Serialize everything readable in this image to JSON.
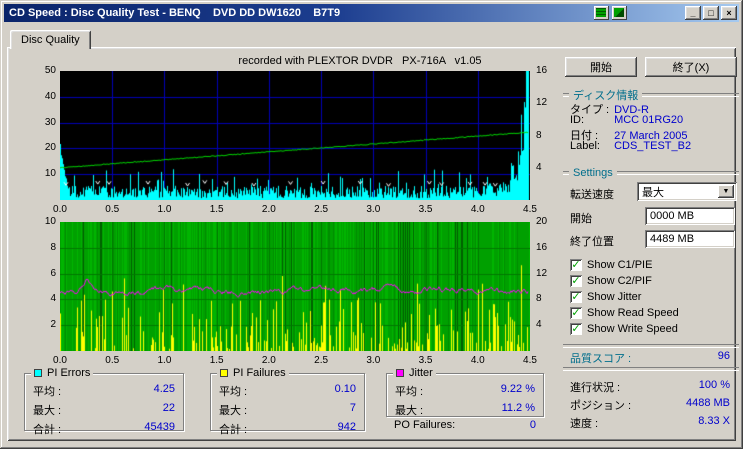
{
  "window": {
    "title": "CD Speed : Disc Quality Test - BENQ    DVD DD DW1620    B7T9"
  },
  "icons": {
    "minimize": "_",
    "maximize": "□",
    "close": "×",
    "check": "✓",
    "dropdown": "▼"
  },
  "tab": {
    "label": "Disc Quality"
  },
  "chart_note": "recorded with PLEXTOR DVDR   PX-716A   v1.05",
  "chart_data": [
    {
      "type": "area",
      "title": "PI Errors / Write Speed",
      "x_ticks": [
        "0.0",
        "0.5",
        "1.0",
        "1.5",
        "2.0",
        "2.5",
        "3.0",
        "3.5",
        "4.0",
        "4.5"
      ],
      "y_left_ticks": [
        "50",
        "40",
        "30",
        "20",
        "10"
      ],
      "y_right_ticks": [
        "16",
        "12",
        "8",
        "4"
      ],
      "y_left_max": 50,
      "y_right_max": 16,
      "x_max": 4.5,
      "x_data_end": 4.48,
      "h_grid": [
        10,
        20,
        30,
        40
      ],
      "grid_color": "#0000b8",
      "bg": "#000000",
      "series": [
        {
          "name": "PI Errors",
          "color": "#00ffff",
          "avg": 4.25,
          "max": 22,
          "total": 45439
        },
        {
          "name": "Write Speed",
          "color": "#00d800",
          "start_x": 4.0,
          "end_x": 8.4
        }
      ]
    },
    {
      "type": "spikes",
      "title": "PI Failures / Jitter",
      "x_ticks": [
        "0.0",
        "0.5",
        "1.0",
        "1.5",
        "2.0",
        "2.5",
        "3.0",
        "3.5",
        "4.0",
        "4.5"
      ],
      "y_left_ticks": [
        "10",
        "8",
        "6",
        "4",
        "2"
      ],
      "y_right_ticks": [
        "20",
        "16",
        "12",
        "8",
        "4"
      ],
      "y_left_max": 10,
      "y_right_max": 20,
      "x_max": 4.5,
      "x_data_end": 4.48,
      "h_grid": [
        2,
        4,
        6,
        8
      ],
      "grid_color": "#007800",
      "bg": "#00a000",
      "series": [
        {
          "name": "PI Failures",
          "color": "#ffff00",
          "avg": 0.1,
          "max": 7,
          "total": 942
        },
        {
          "name": "Jitter",
          "color": "#ff00ff",
          "avg_pct": 9.22,
          "max_pct": 11.2
        }
      ]
    }
  ],
  "stats": {
    "pi_errors": {
      "title": "PI Errors",
      "color": "#00ffff",
      "rows": [
        {
          "label": "平均 :",
          "value": "4.25"
        },
        {
          "label": "最大 :",
          "value": "22"
        },
        {
          "label": "合計 :",
          "value": "45439"
        }
      ]
    },
    "pi_failures": {
      "title": "PI Failures",
      "color": "#ffff00",
      "rows": [
        {
          "label": "平均 :",
          "value": "0.10"
        },
        {
          "label": "最大 :",
          "value": "7"
        },
        {
          "label": "合計 :",
          "value": "942"
        }
      ]
    },
    "jitter": {
      "title": "Jitter",
      "color": "#ff00ff",
      "rows": [
        {
          "label": "平均 :",
          "value": "9.22 %"
        },
        {
          "label": "最大 :",
          "value": "11.2 %"
        }
      ]
    },
    "po_failures": {
      "label": "PO Failures:",
      "value": "0"
    }
  },
  "sidebar": {
    "start_button": "開始",
    "exit_button": "終了(X)",
    "disc_info": {
      "title": "ディスク情報",
      "rows": [
        {
          "label": "タイプ :",
          "value": "DVD-R"
        },
        {
          "label": "ID:",
          "value": "MCC 01RG20"
        },
        {
          "label": "日付 :",
          "value": "27 March 2005"
        },
        {
          "label": "Label:",
          "value": "CDS_TEST_B2"
        }
      ]
    },
    "settings": {
      "title": "Settings",
      "transfer_label": "転送速度",
      "transfer_value": "最大",
      "start_label": "開始",
      "start_value": "0000 MB",
      "end_label": "終了位置",
      "end_value": "4489 MB",
      "checkboxes": [
        "Show C1/PIE",
        "Show C2/PIF",
        "Show Jitter",
        "Show Read Speed",
        "Show Write Speed"
      ]
    },
    "quality": {
      "label": "品質スコア :",
      "value": "96"
    },
    "progress": {
      "label": "進行状況 :",
      "value": "100 %"
    },
    "position": {
      "label": "ポジション :",
      "value": "4488 MB"
    },
    "speed": {
      "label": "速度 :",
      "value": "8.33 X"
    }
  }
}
